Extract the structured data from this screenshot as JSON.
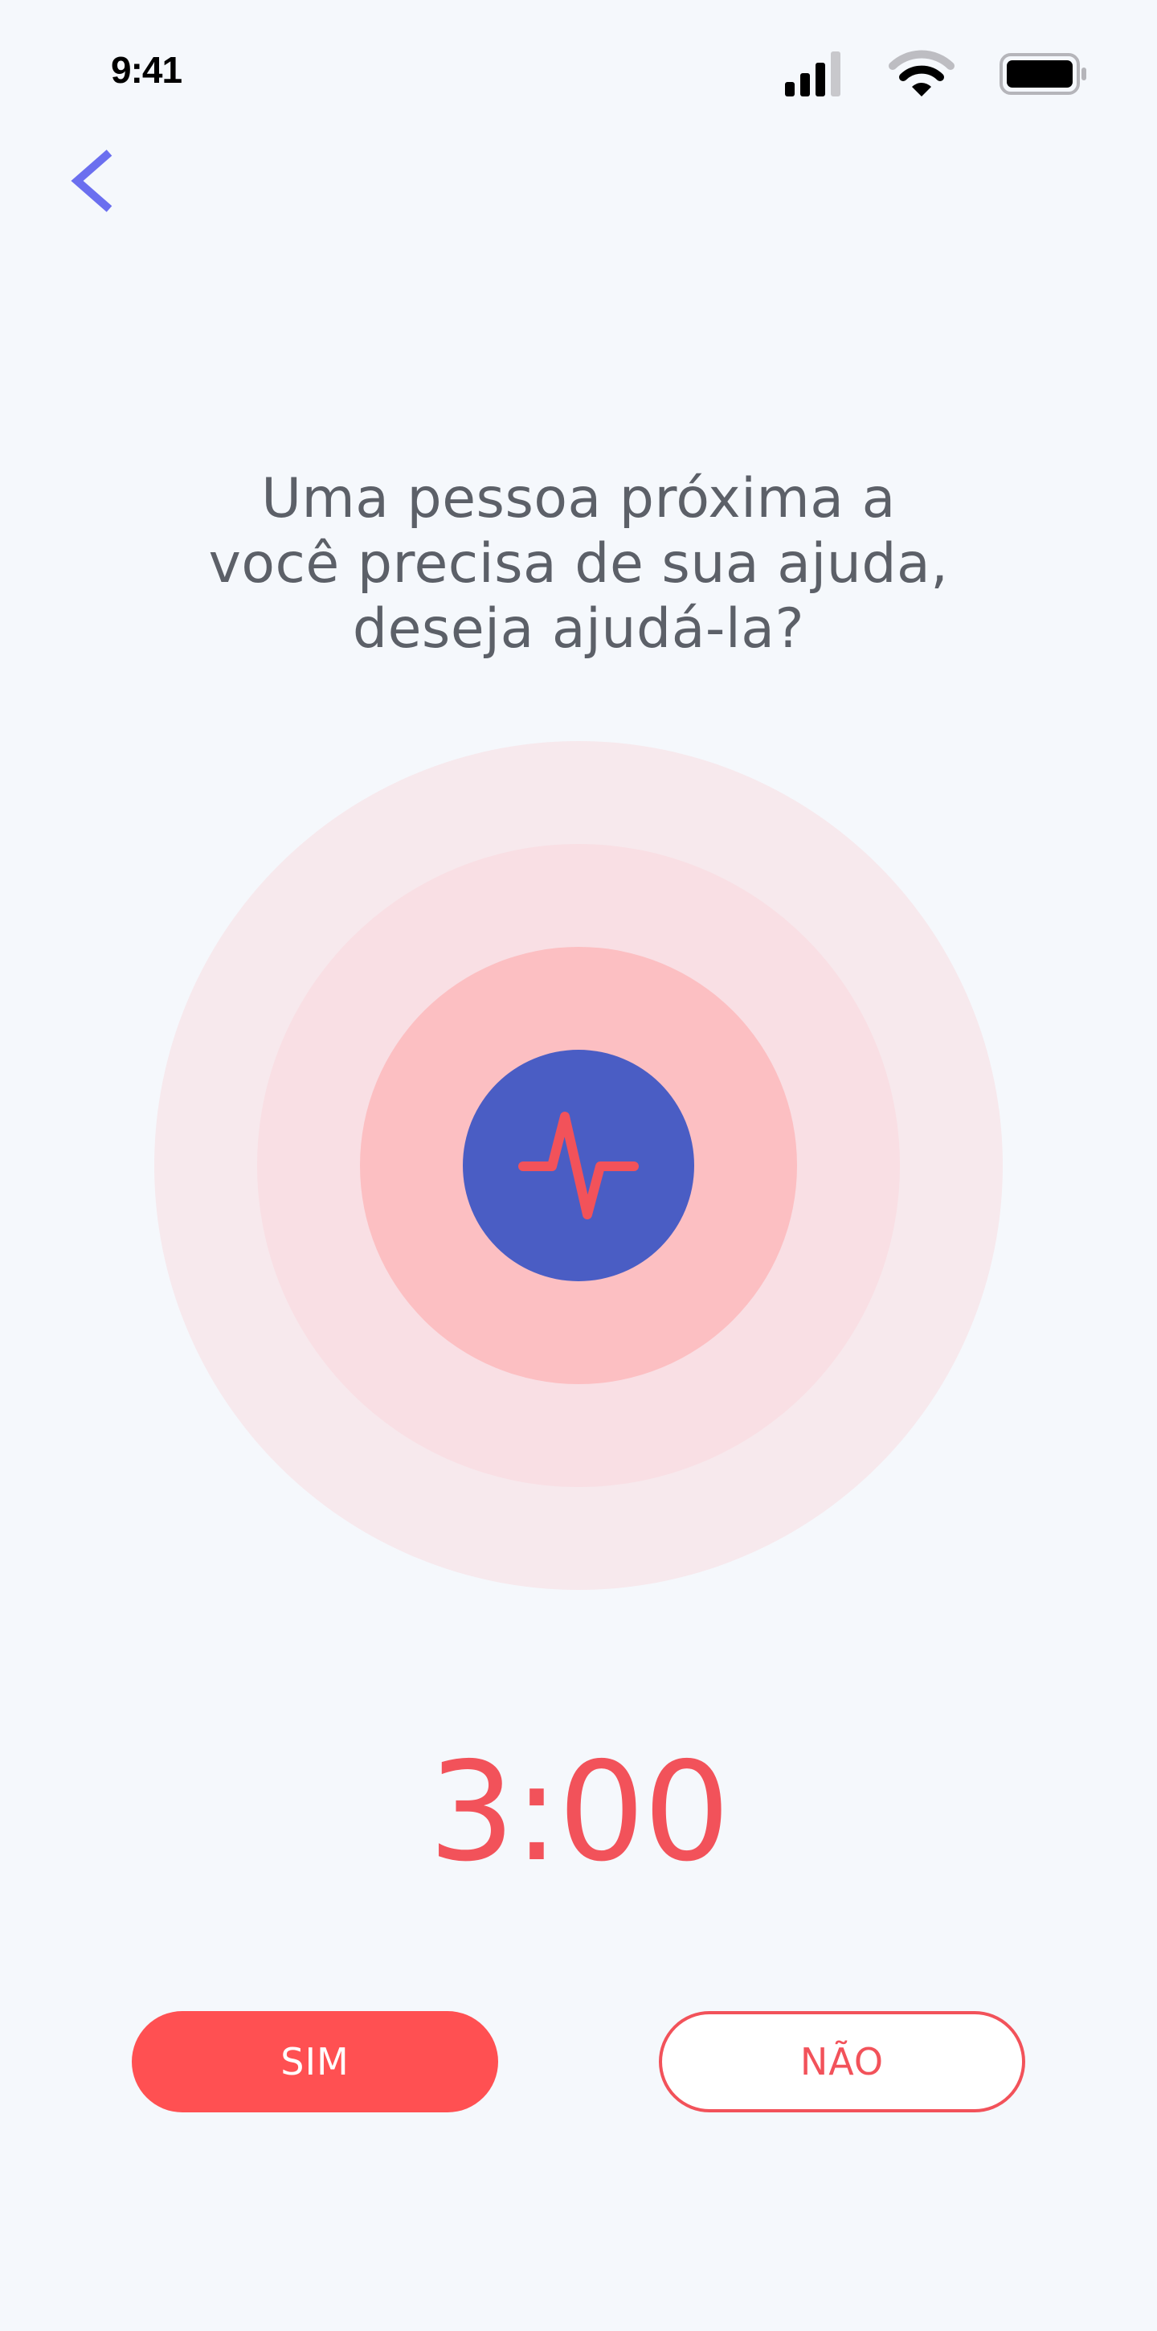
{
  "status_bar": {
    "time": "9:41",
    "icons": [
      "cellular-signal-icon",
      "wifi-icon",
      "battery-icon"
    ]
  },
  "navigation": {
    "back_icon": "chevron-left-icon"
  },
  "prompt": {
    "line1": "Uma pessoa próxima a",
    "line2": "você precisa de sua ajuda,",
    "line3": "deseja ajudá-la?"
  },
  "pulse": {
    "icon": "activity-pulse-icon"
  },
  "timer": {
    "value": "3:00"
  },
  "actions": {
    "yes_label": "SIM",
    "no_label": "NÃO"
  },
  "colors": {
    "background": "#F5F8FC",
    "accent_red": "#F2525A",
    "button_red": "#FF5052",
    "pulse_blue": "#4A5DC4",
    "back_purple": "#6B6FEF",
    "text_gray": "#5C6068",
    "ring_outer": "#F7E9ED",
    "ring_mid": "#F9DFE4",
    "ring_inner": "#FCBFC2"
  }
}
